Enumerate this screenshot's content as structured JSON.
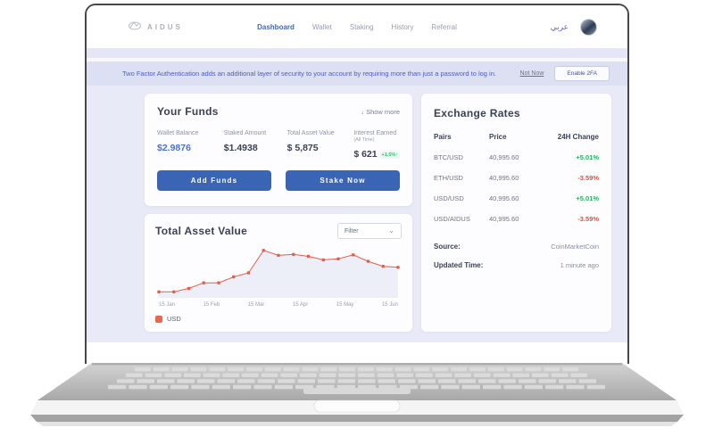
{
  "nav": {
    "brand": "AIDUS",
    "items": [
      {
        "label": "Dashboard",
        "active": true
      },
      {
        "label": "Wallet",
        "active": false
      },
      {
        "label": "Staking",
        "active": false
      },
      {
        "label": "History",
        "active": false
      },
      {
        "label": "Referral",
        "active": false
      }
    ],
    "language": "عربي"
  },
  "banner": {
    "message": "Two Factor Authentication adds an additional layer of security to  your account by requiring more than just a password to log in.",
    "not_now": "Not Now",
    "enable_2fa": "Enable 2FA"
  },
  "funds": {
    "title": "Your Funds",
    "show_more_icon": "↓",
    "show_more": "Show more",
    "stats": [
      {
        "label": "Wallet Balance",
        "value": "$2.9876"
      },
      {
        "label": "Staked Amount",
        "value": "$1.4938"
      },
      {
        "label": "Total Asset Value",
        "value": "$ 5,875"
      },
      {
        "label": "Interest Earned",
        "sublabel": "(All Time)",
        "value": "$ 621",
        "badge": "+1.5%↑"
      }
    ],
    "buttons": {
      "add_funds": "Add Funds",
      "stake_now": "Stake Now"
    }
  },
  "chart_data": {
    "type": "line",
    "title": "Total Asset Value",
    "filter_label": "Filter",
    "filter_chevron": "⌄",
    "x_tick_labels": [
      "15 Jan",
      "15 Feb",
      "15 Mar",
      "15 Apr",
      "15 May",
      "15 Jun"
    ],
    "series": [
      {
        "name": "USD",
        "values": [
          12,
          12,
          19,
          30,
          30,
          42,
          50,
          95,
          85,
          87,
          83,
          76,
          78,
          86,
          73,
          63,
          61
        ]
      }
    ],
    "ylim": [
      0,
      100
    ],
    "y_axis_shown": false,
    "grid": false,
    "legend": [
      "USD"
    ],
    "legend_position": "bottom-left",
    "line_color": "#e0604b",
    "marker": "square",
    "area_fill": "rgba(203,209,235,0.35)"
  },
  "rates": {
    "title": "Exchange Rates",
    "headers": [
      "Pairs",
      "Price",
      "24H Change"
    ],
    "rows": [
      {
        "pair": "BTC/USD",
        "price": "40,995.60",
        "change": "+5.01%",
        "dir": "up"
      },
      {
        "pair": "ETH/USD",
        "price": "40,995.60",
        "change": "-3.59%",
        "dir": "down"
      },
      {
        "pair": "USD/USD",
        "price": "40,995.60",
        "change": "+5.01%",
        "dir": "up"
      },
      {
        "pair": "USD/AIDUS",
        "price": "40,995.60",
        "change": "-3.59%",
        "dir": "down"
      }
    ],
    "source_label": "Source:",
    "source_value": "CoinMarketCoin",
    "updated_label": "Updated Time:",
    "updated_value": "1 minute ago"
  },
  "colors": {
    "accent_blue": "#3a65b4",
    "active_link": "#4168b7",
    "positive": "#27ae60",
    "negative": "#e74c3c",
    "banner_bg": "#dde0f3",
    "main_bg": "#e9eaf8",
    "chart_line": "#e0604b",
    "legend_swatch": "#e8684a"
  }
}
